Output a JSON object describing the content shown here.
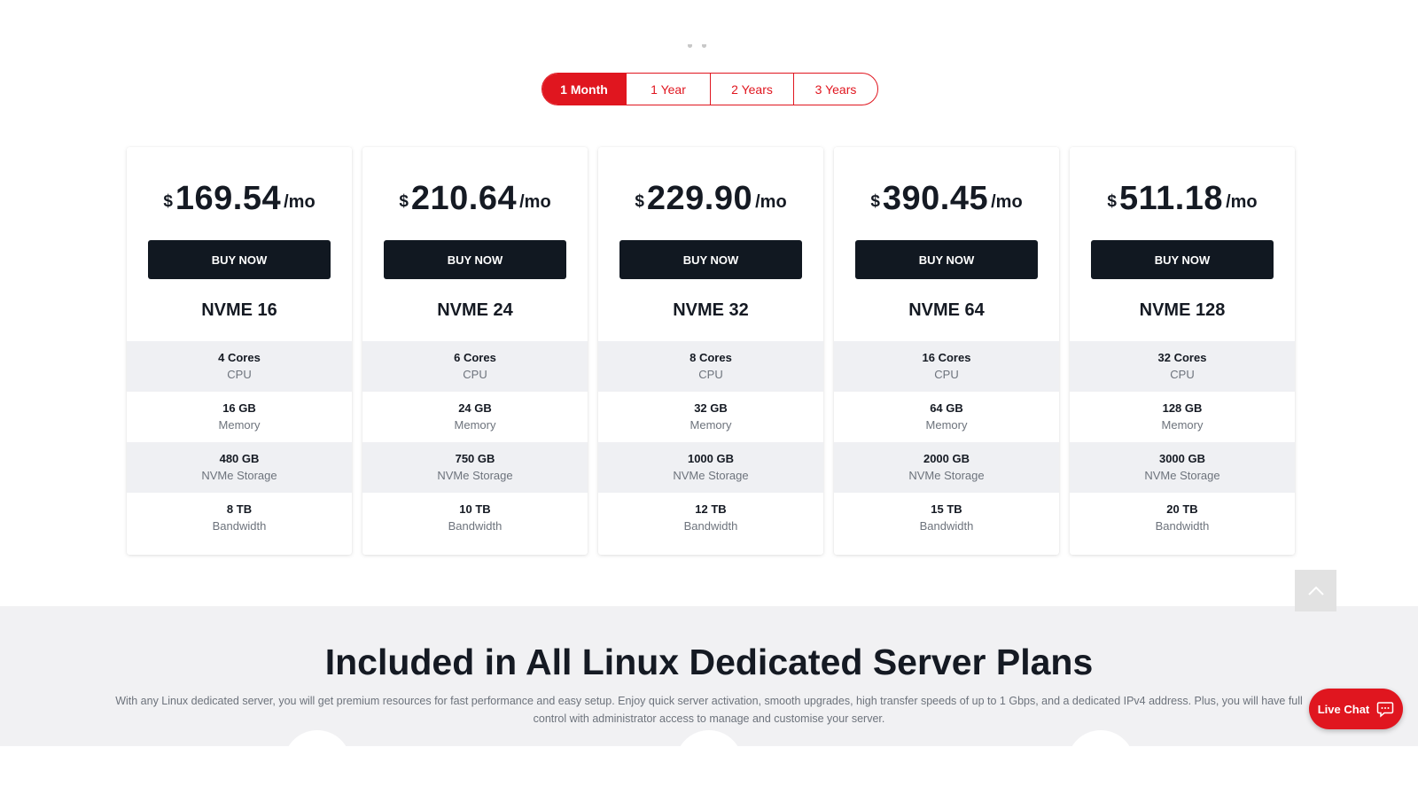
{
  "billing_periods": [
    {
      "label": "1 Month",
      "active": true
    },
    {
      "label": "1 Year",
      "active": false
    },
    {
      "label": "2 Years",
      "active": false
    },
    {
      "label": "3 Years",
      "active": false
    }
  ],
  "plans": [
    {
      "currency": "$",
      "price": "169.54",
      "unit": "/mo",
      "button": "BUY NOW",
      "name": "NVME 16",
      "specs": [
        {
          "value": "4 Cores",
          "label": "CPU"
        },
        {
          "value": "16 GB",
          "label": "Memory"
        },
        {
          "value": "480 GB",
          "label": "NVMe Storage"
        },
        {
          "value": "8 TB",
          "label": "Bandwidth"
        }
      ]
    },
    {
      "currency": "$",
      "price": "210.64",
      "unit": "/mo",
      "button": "BUY NOW",
      "name": "NVME 24",
      "specs": [
        {
          "value": "6 Cores",
          "label": "CPU"
        },
        {
          "value": "24 GB",
          "label": "Memory"
        },
        {
          "value": "750 GB",
          "label": "NVMe Storage"
        },
        {
          "value": "10 TB",
          "label": "Bandwidth"
        }
      ]
    },
    {
      "currency": "$",
      "price": "229.90",
      "unit": "/mo",
      "button": "BUY NOW",
      "name": "NVME 32",
      "specs": [
        {
          "value": "8 Cores",
          "label": "CPU"
        },
        {
          "value": "32 GB",
          "label": "Memory"
        },
        {
          "value": "1000 GB",
          "label": "NVMe Storage"
        },
        {
          "value": "12 TB",
          "label": "Bandwidth"
        }
      ]
    },
    {
      "currency": "$",
      "price": "390.45",
      "unit": "/mo",
      "button": "BUY NOW",
      "name": "NVME 64",
      "specs": [
        {
          "value": "16 Cores",
          "label": "CPU"
        },
        {
          "value": "64 GB",
          "label": "Memory"
        },
        {
          "value": "2000 GB",
          "label": "NVMe Storage"
        },
        {
          "value": "15 TB",
          "label": "Bandwidth"
        }
      ]
    },
    {
      "currency": "$",
      "price": "511.18",
      "unit": "/mo",
      "button": "BUY NOW",
      "name": "NVME 128",
      "specs": [
        {
          "value": "32 Cores",
          "label": "CPU"
        },
        {
          "value": "128 GB",
          "label": "Memory"
        },
        {
          "value": "3000 GB",
          "label": "NVMe Storage"
        },
        {
          "value": "20 TB",
          "label": "Bandwidth"
        }
      ]
    }
  ],
  "included": {
    "title": "Included in All Linux Dedicated Server Plans",
    "description": "With any Linux dedicated server, you will get premium resources for fast performance and easy setup. Enjoy quick server activation, smooth upgrades, high transfer speeds of up to 1 Gbps, and a dedicated IPv4 address. Plus, you will have full control with administrator access to manage and customise your server."
  },
  "live_chat": {
    "label": "Live Chat",
    "icon": "chat-bubble-icon"
  },
  "scroll_top": {
    "icon": "chevron-up-icon"
  },
  "colors": {
    "accent": "#e0161f",
    "dark_button": "#111821",
    "text": "#151a23",
    "muted": "#6d737c",
    "row_shade": "#eff0f3",
    "section_bg": "#f1f1f3"
  }
}
